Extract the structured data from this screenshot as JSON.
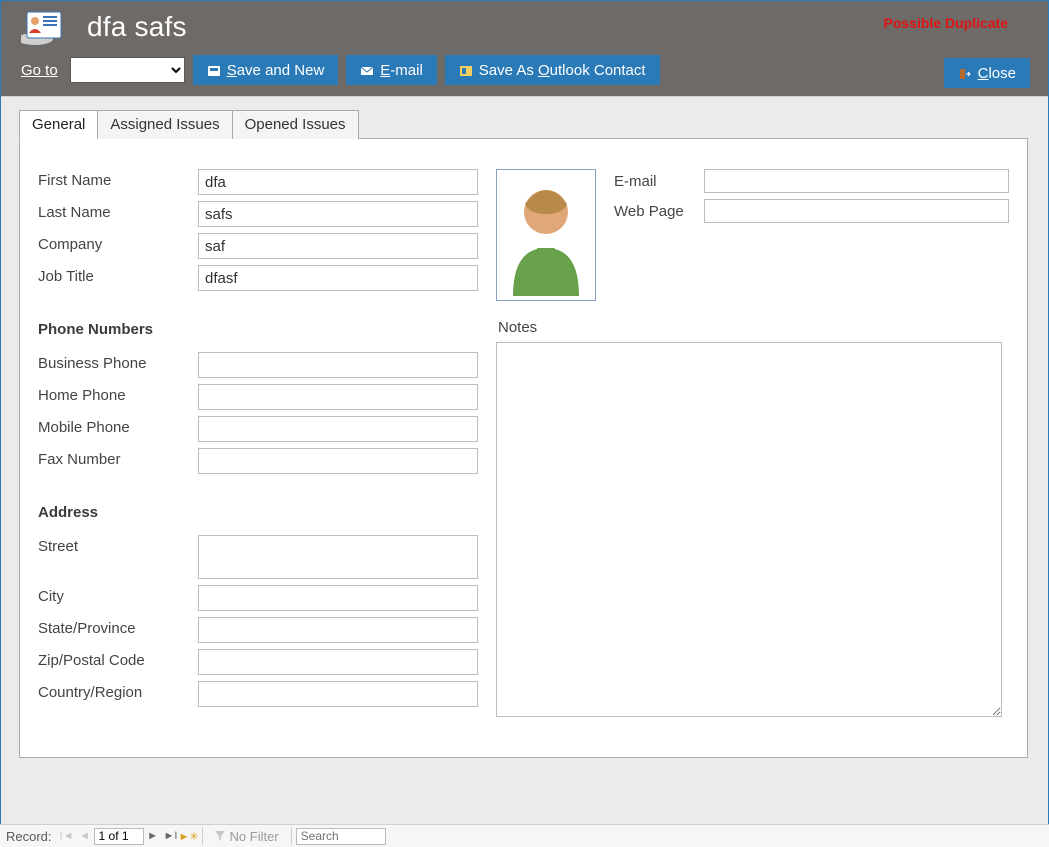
{
  "header": {
    "title": "dfa safs",
    "duplicate_warning": "Possible Duplicate"
  },
  "toolbar": {
    "goto_label_pre": "G",
    "goto_label_post": "o to",
    "goto_selected": "",
    "save_new_pre": "S",
    "save_new_post": "ave and New",
    "email_pre": "E",
    "email_post": "-mail",
    "save_outlook_pre": "Save As ",
    "save_outlook_ul": "O",
    "save_outlook_post": "utlook Contact",
    "close_pre": "C",
    "close_post": "lose"
  },
  "tabs": {
    "general": "General",
    "assigned": "Assigned Issues",
    "opened": "Opened Issues"
  },
  "form": {
    "labels": {
      "first_name": "First Name",
      "last_name": "Last Name",
      "company": "Company",
      "job_title": "Job Title",
      "phone_section": "Phone Numbers",
      "business_phone": "Business Phone",
      "home_phone": "Home Phone",
      "mobile_phone": "Mobile Phone",
      "fax_number": "Fax Number",
      "address_section": "Address",
      "street": "Street",
      "city": "City",
      "state": "State/Province",
      "zip": "Zip/Postal Code",
      "country": "Country/Region",
      "email": "E-mail",
      "webpage": "Web Page",
      "notes": "Notes"
    },
    "values": {
      "first_name": "dfa",
      "last_name": "safs",
      "company": "saf",
      "job_title": "dfasf",
      "business_phone": "",
      "home_phone": "",
      "mobile_phone": "",
      "fax_number": "",
      "street": "",
      "city": "",
      "state": "",
      "zip": "",
      "country": "",
      "email": "",
      "webpage": "",
      "notes": ""
    }
  },
  "statusbar": {
    "record_label": "Record:",
    "record_pos": "1 of 1",
    "no_filter": "No Filter",
    "search_placeholder": "Search"
  }
}
